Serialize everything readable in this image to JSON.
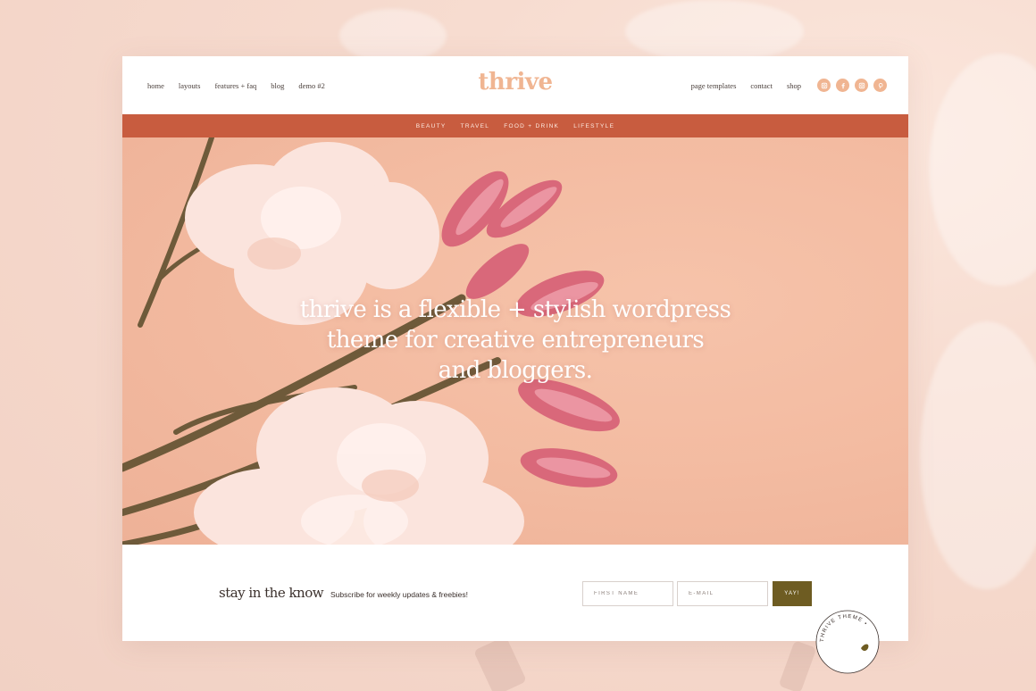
{
  "header": {
    "logo": "thrive",
    "nav_left": [
      "home",
      "layouts",
      "features + faq",
      "blog",
      "demo #2"
    ],
    "nav_right": [
      "page templates",
      "contact",
      "shop"
    ],
    "social_icons": [
      "instagram-icon",
      "facebook-icon",
      "instagram-icon",
      "pinterest-icon"
    ]
  },
  "categories": [
    "BEAUTY",
    "TRAVEL",
    "FOOD + DRINK",
    "LIFESTYLE"
  ],
  "hero": {
    "line1": "thrive is a flexible + stylish wordpress",
    "line2": "theme for creative entrepreneurs",
    "line3": "and bloggers."
  },
  "subscribe": {
    "title": "stay in the know",
    "description": "Subscribe for weekly updates & freebies!",
    "first_name_placeholder": "FIRST NAME",
    "email_placeholder": "E-MAIL",
    "button_label": "YAY!"
  },
  "badge": {
    "text": "THRIVE THEME •"
  },
  "colors": {
    "accent": "#f0b592",
    "category_bar": "#c85c3f",
    "button": "#6e5c22",
    "hero_bg": "#f3bba1"
  }
}
